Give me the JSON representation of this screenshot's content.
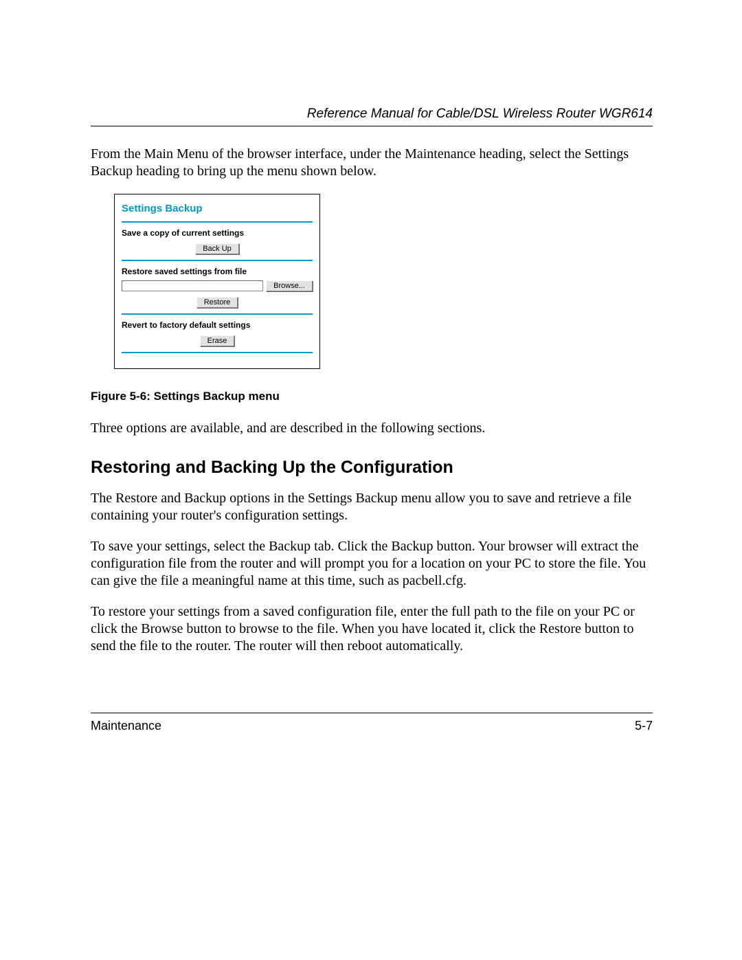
{
  "header": {
    "title": "Reference Manual for Cable/DSL Wireless Router WGR614"
  },
  "intro_para": "From the Main Menu of the browser interface, under the Maintenance heading, select the Settings Backup heading to bring up the menu shown below.",
  "screenshot": {
    "title": "Settings Backup",
    "section1_label": "Save a copy of current settings",
    "backup_btn": "Back Up",
    "section2_label": "Restore saved settings from file",
    "browse_btn": "Browse...",
    "restore_btn": "Restore",
    "section3_label": "Revert to factory default settings",
    "erase_btn": "Erase"
  },
  "figure_caption": "Figure 5-6:  Settings Backup menu",
  "para2": "Three options are available, and are described in the following sections.",
  "section_heading": "Restoring and Backing Up the Configuration",
  "para3": "The Restore and Backup options in the Settings Backup menu allow you to save and retrieve a file containing your router's configuration settings.",
  "para4": "To save your settings, select the Backup tab. Click the Backup button. Your browser will extract the configuration file from the router and will prompt you for a location on your PC to store the file. You can give the file a meaningful name at this time, such as pacbell.cfg.",
  "para5": "To restore your settings from a saved configuration file, enter the full path to the file on your PC or click the Browse button to browse to the file. When you have located it, click the Restore button to send the file to the router. The router will then reboot automatically.",
  "footer": {
    "left": "Maintenance",
    "right": "5-7"
  }
}
